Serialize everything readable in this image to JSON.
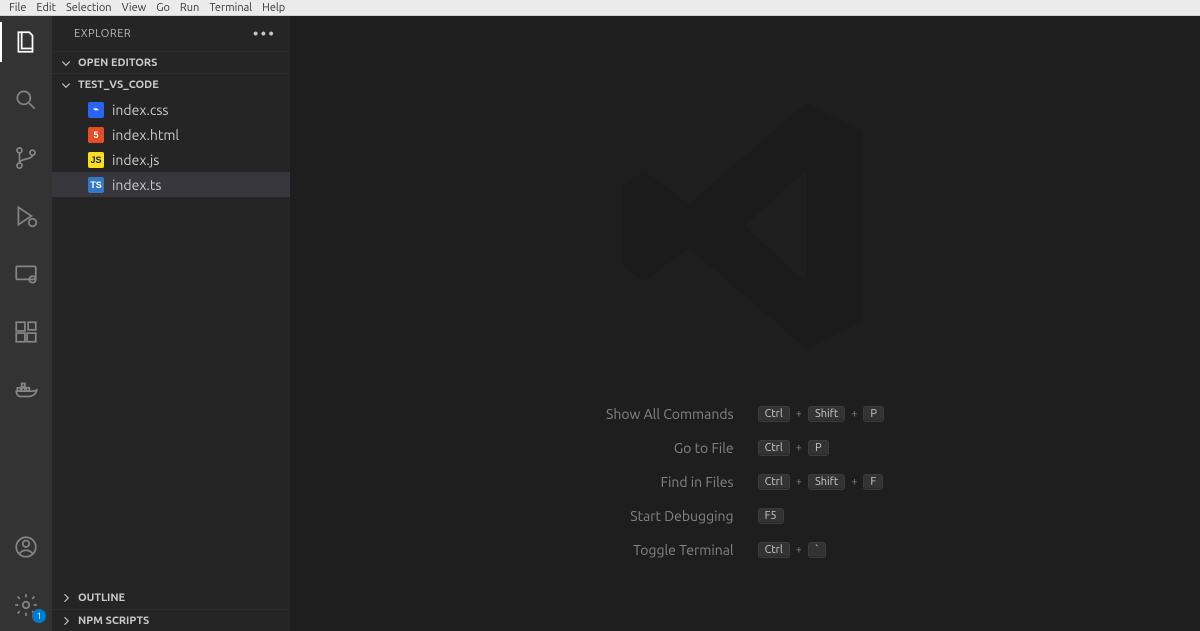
{
  "menu": {
    "items": [
      "File",
      "Edit",
      "Selection",
      "View",
      "Go",
      "Run",
      "Terminal",
      "Help"
    ]
  },
  "activity": {
    "items": [
      {
        "name": "explorer",
        "active": true
      },
      {
        "name": "search"
      },
      {
        "name": "scm"
      },
      {
        "name": "debug"
      },
      {
        "name": "remote"
      },
      {
        "name": "extensions"
      },
      {
        "name": "docker"
      }
    ],
    "bottom": [
      {
        "name": "accounts"
      },
      {
        "name": "settings",
        "badge": "1"
      }
    ]
  },
  "sidebar": {
    "title": "EXPLORER",
    "sections": {
      "openEditors": {
        "label": "OPEN EDITORS",
        "expanded": true
      },
      "workspace": {
        "label": "TEST_VS_CODE",
        "expanded": true,
        "files": [
          {
            "name": "index.css",
            "type": "css",
            "selected": false
          },
          {
            "name": "index.html",
            "type": "html",
            "selected": false
          },
          {
            "name": "index.js",
            "type": "js",
            "selected": false
          },
          {
            "name": "index.ts",
            "type": "ts",
            "selected": true
          }
        ]
      },
      "outline": {
        "label": "OUTLINE",
        "expanded": false
      },
      "npm": {
        "label": "NPM SCRIPTS",
        "expanded": false
      }
    }
  },
  "welcome": {
    "shortcuts": [
      {
        "label": "Show All Commands",
        "keys": [
          "Ctrl",
          "Shift",
          "P"
        ]
      },
      {
        "label": "Go to File",
        "keys": [
          "Ctrl",
          "P"
        ]
      },
      {
        "label": "Find in Files",
        "keys": [
          "Ctrl",
          "Shift",
          "F"
        ]
      },
      {
        "label": "Start Debugging",
        "keys": [
          "F5"
        ]
      },
      {
        "label": "Toggle Terminal",
        "keys": [
          "Ctrl",
          "`"
        ]
      }
    ]
  }
}
